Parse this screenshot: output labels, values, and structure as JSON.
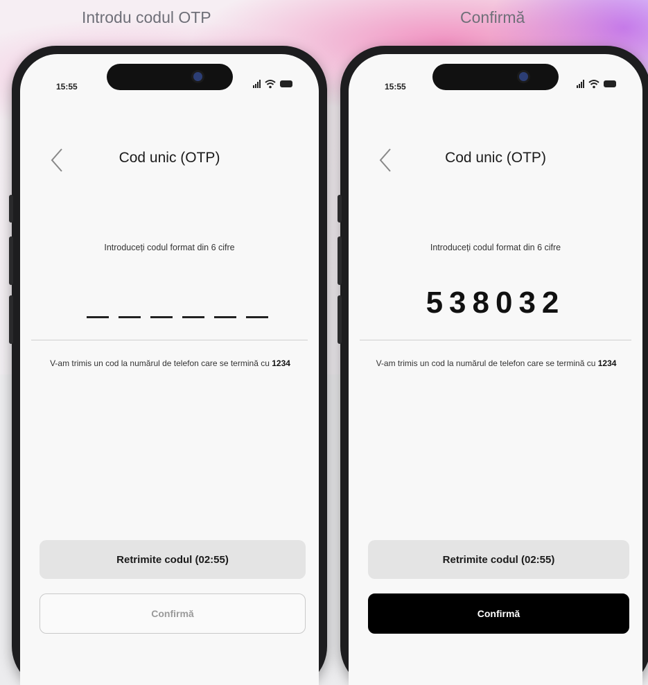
{
  "steps": [
    {
      "title": "Introdu codul OTP",
      "status_time": "15:55",
      "screen_title": "Cod unic (OTP)",
      "prompt": "Introduceți codul format din 6 cifre",
      "code_value": "",
      "info_text": "V-am trimis un cod la numărul de telefon care se termină cu",
      "phone_suffix": "1234",
      "resend_label": "Retrimite codul (02:55)",
      "confirm_label": "Confirmă",
      "confirm_state": "disabled"
    },
    {
      "title": "Confirmă",
      "status_time": "15:55",
      "screen_title": "Cod unic (OTP)",
      "prompt": "Introduceți codul format din 6 cifre",
      "code_value": "538032",
      "info_text": "V-am trimis un cod la numărul de telefon care se termină cu",
      "phone_suffix": "1234",
      "resend_label": "Retrimite codul (02:55)",
      "confirm_label": "Confirmă",
      "confirm_state": "active"
    }
  ],
  "icons": {
    "back": "chevron-left-icon",
    "signal": "cellular-signal-icon",
    "wifi": "wifi-icon",
    "battery": "battery-icon",
    "camera": "front-camera-icon"
  },
  "colors": {
    "confirm_active_bg": "#000000",
    "resend_bg": "#e4e4e4",
    "accent_pink": "#ec4899",
    "accent_purple": "#a855f7"
  }
}
